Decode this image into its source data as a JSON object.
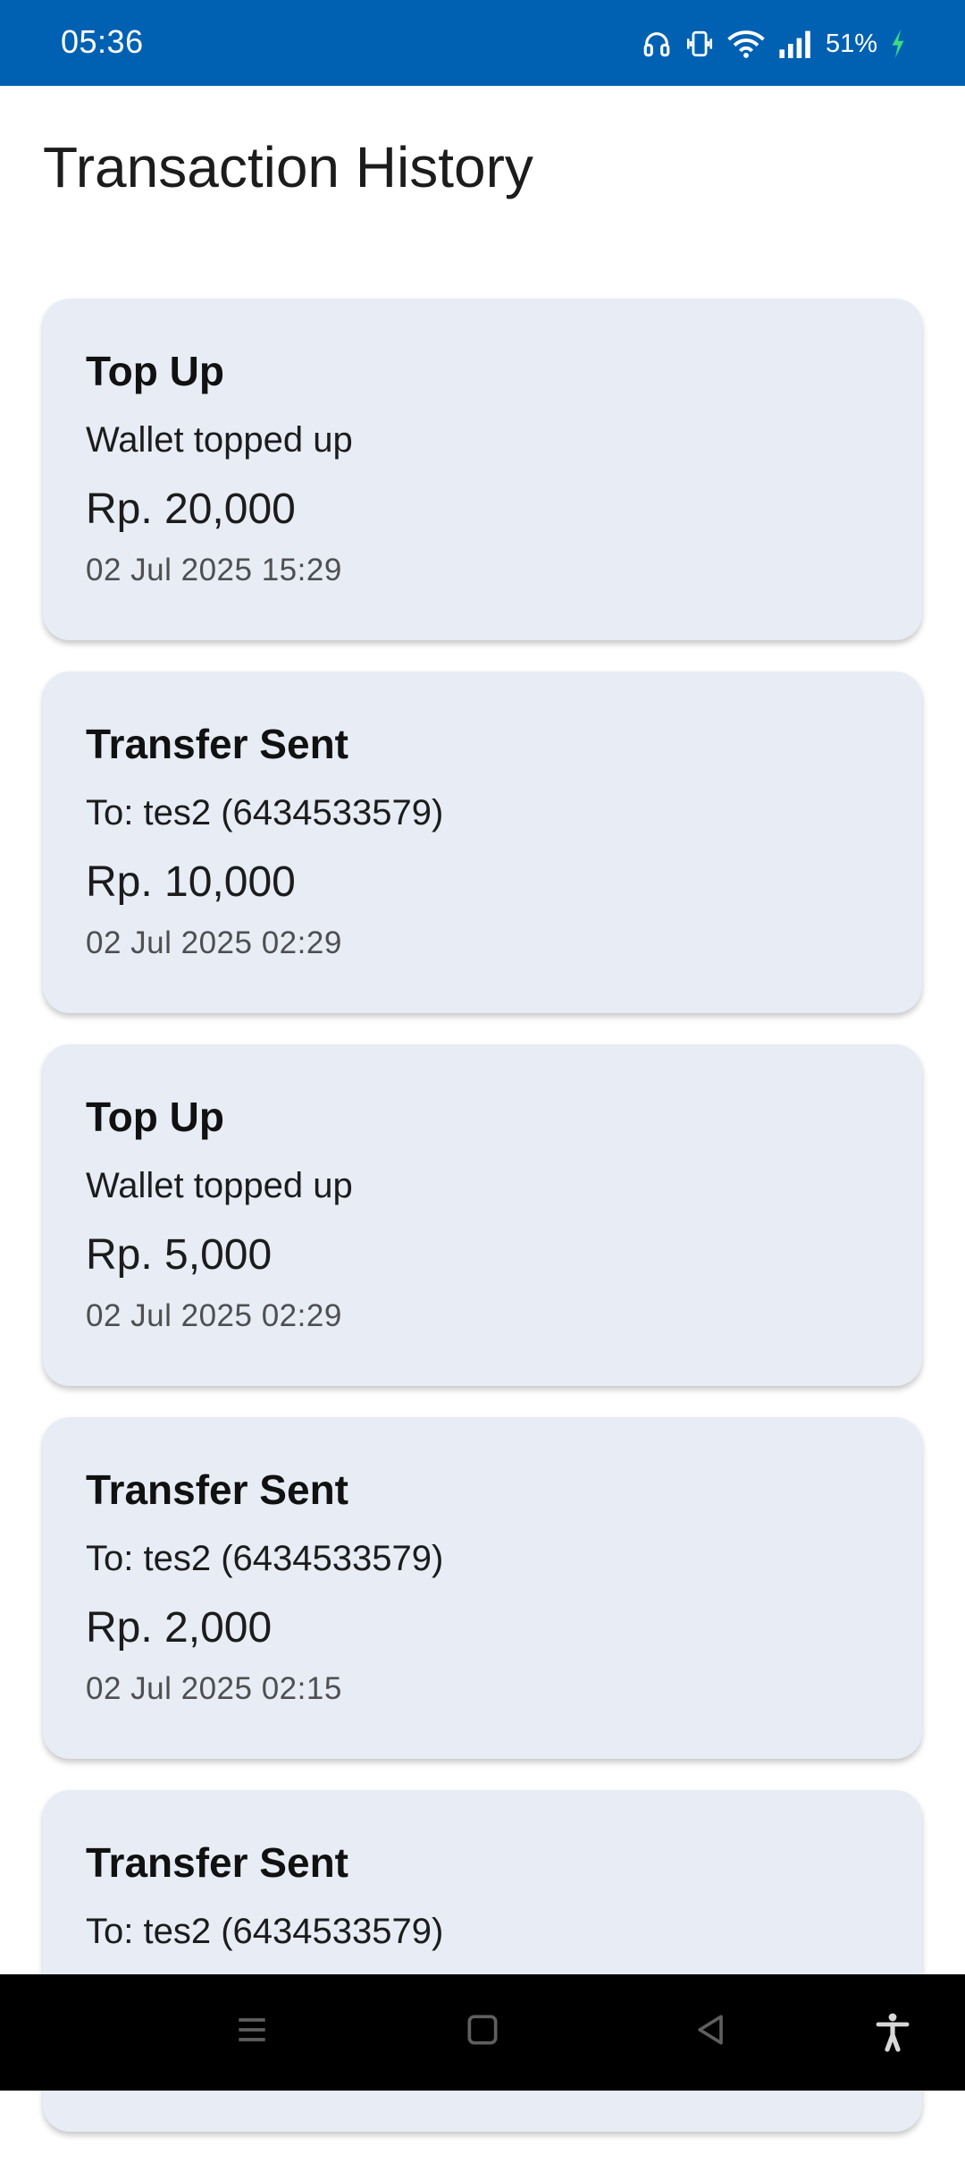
{
  "status_bar": {
    "time": "05:36",
    "battery": "51%",
    "background_color": "#0061b2",
    "icons": [
      "headphones-icon",
      "vibrate-icon",
      "wifi-icon",
      "signal-icon",
      "charging-icon"
    ]
  },
  "page": {
    "title": "Transaction History"
  },
  "transactions": [
    {
      "type": "Top Up",
      "description": "Wallet topped up",
      "amount": "Rp. 20,000",
      "date": "02 Jul 2025 15:29"
    },
    {
      "type": "Transfer Sent",
      "description": "To: tes2 (6434533579)",
      "amount": "Rp. 10,000",
      "date": "02 Jul 2025 02:29"
    },
    {
      "type": "Top Up",
      "description": "Wallet topped up",
      "amount": "Rp. 5,000",
      "date": "02 Jul 2025 02:29"
    },
    {
      "type": "Transfer Sent",
      "description": "To: tes2 (6434533579)",
      "amount": "Rp. 2,000",
      "date": "02 Jul 2025 02:15"
    },
    {
      "type": "Transfer Sent",
      "description": "To: tes2 (6434533579)",
      "amount": "",
      "date": ""
    }
  ],
  "nav_bar": {
    "icons": [
      "recents-icon",
      "home-icon",
      "back-icon",
      "accessibility-icon"
    ]
  },
  "colors": {
    "card_background": "#e7ecf5",
    "accent": "#0061b2"
  }
}
